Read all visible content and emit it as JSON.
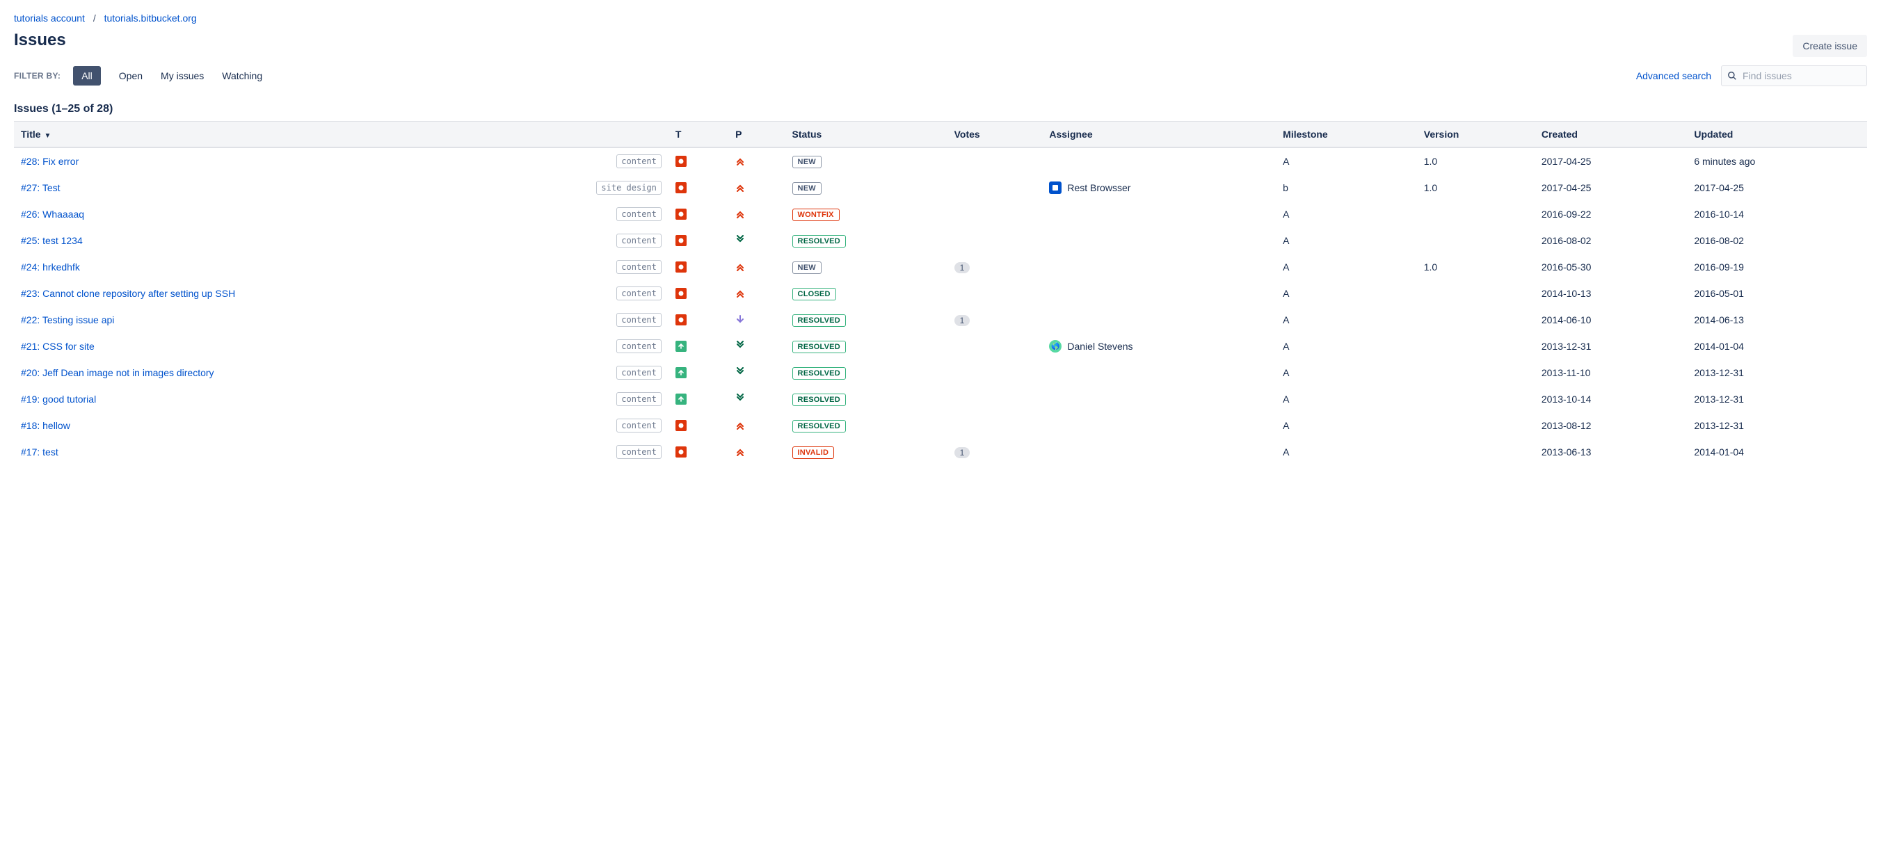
{
  "breadcrumb": {
    "account": "tutorials account",
    "repo": "tutorials.bitbucket.org"
  },
  "page_title": "Issues",
  "create_button": "Create issue",
  "filter_label": "FILTER BY:",
  "filters": [
    {
      "label": "All",
      "active": true
    },
    {
      "label": "Open",
      "active": false
    },
    {
      "label": "My issues",
      "active": false
    },
    {
      "label": "Watching",
      "active": false
    }
  ],
  "advanced_search": "Advanced search",
  "search_placeholder": "Find issues",
  "summary": "Issues (1–25 of 28)",
  "columns": {
    "title": "Title",
    "type": "T",
    "priority": "P",
    "status": "Status",
    "votes": "Votes",
    "assignee": "Assignee",
    "milestone": "Milestone",
    "version": "Version",
    "created": "Created",
    "updated": "Updated"
  },
  "issues": [
    {
      "id": "#28",
      "title": "Fix error",
      "tag": "content",
      "type": "bug",
      "priority": "highest",
      "status": "NEW",
      "status_class": "st-new",
      "votes": "",
      "assignee": "",
      "avatar": "",
      "milestone": "A",
      "version": "1.0",
      "created": "2017-04-25",
      "updated": "6 minutes ago"
    },
    {
      "id": "#27",
      "title": "Test",
      "tag": "site design",
      "type": "bug",
      "priority": "highest",
      "status": "NEW",
      "status_class": "st-new",
      "votes": "",
      "assignee": "Rest Browsser",
      "avatar": "bb",
      "milestone": "b",
      "version": "1.0",
      "created": "2017-04-25",
      "updated": "2017-04-25"
    },
    {
      "id": "#26",
      "title": "Whaaaaq",
      "tag": "content",
      "type": "bug",
      "priority": "highest",
      "status": "WONTFIX",
      "status_class": "st-wontfix",
      "votes": "",
      "assignee": "",
      "avatar": "",
      "milestone": "A",
      "version": "",
      "created": "2016-09-22",
      "updated": "2016-10-14"
    },
    {
      "id": "#25",
      "title": "test 1234",
      "tag": "content",
      "type": "bug",
      "priority": "lowest",
      "status": "RESOLVED",
      "status_class": "st-resolved",
      "votes": "",
      "assignee": "",
      "avatar": "",
      "milestone": "A",
      "version": "",
      "created": "2016-08-02",
      "updated": "2016-08-02"
    },
    {
      "id": "#24",
      "title": "hrkedhfk",
      "tag": "content",
      "type": "bug",
      "priority": "highest",
      "status": "NEW",
      "status_class": "st-new",
      "votes": "1",
      "assignee": "",
      "avatar": "",
      "milestone": "A",
      "version": "1.0",
      "created": "2016-05-30",
      "updated": "2016-09-19"
    },
    {
      "id": "#23",
      "title": "Cannot clone repository after setting up SSH",
      "tag": "content",
      "type": "bug",
      "priority": "highest",
      "status": "CLOSED",
      "status_class": "st-closed",
      "votes": "",
      "assignee": "",
      "avatar": "",
      "milestone": "A",
      "version": "",
      "created": "2014-10-13",
      "updated": "2016-05-01"
    },
    {
      "id": "#22",
      "title": "Testing issue api",
      "tag": "content",
      "type": "bug",
      "priority": "low",
      "status": "RESOLVED",
      "status_class": "st-resolved",
      "votes": "1",
      "assignee": "",
      "avatar": "",
      "milestone": "A",
      "version": "",
      "created": "2014-06-10",
      "updated": "2014-06-13"
    },
    {
      "id": "#21",
      "title": "CSS for site",
      "tag": "content",
      "type": "improvement",
      "priority": "lowest",
      "status": "RESOLVED",
      "status_class": "st-resolved",
      "votes": "",
      "assignee": "Daniel Stevens",
      "avatar": "user",
      "milestone": "A",
      "version": "",
      "created": "2013-12-31",
      "updated": "2014-01-04"
    },
    {
      "id": "#20",
      "title": "Jeff Dean image not in images directory",
      "tag": "content",
      "type": "improvement",
      "priority": "lowest",
      "status": "RESOLVED",
      "status_class": "st-resolved",
      "votes": "",
      "assignee": "",
      "avatar": "",
      "milestone": "A",
      "version": "",
      "created": "2013-11-10",
      "updated": "2013-12-31"
    },
    {
      "id": "#19",
      "title": "good tutorial",
      "tag": "content",
      "type": "improvement",
      "priority": "lowest",
      "status": "RESOLVED",
      "status_class": "st-resolved",
      "votes": "",
      "assignee": "",
      "avatar": "",
      "milestone": "A",
      "version": "",
      "created": "2013-10-14",
      "updated": "2013-12-31"
    },
    {
      "id": "#18",
      "title": "hellow",
      "tag": "content",
      "type": "bug",
      "priority": "highest",
      "status": "RESOLVED",
      "status_class": "st-resolved",
      "votes": "",
      "assignee": "",
      "avatar": "",
      "milestone": "A",
      "version": "",
      "created": "2013-08-12",
      "updated": "2013-12-31"
    },
    {
      "id": "#17",
      "title": "test",
      "tag": "content",
      "type": "bug",
      "priority": "highest",
      "status": "INVALID",
      "status_class": "st-invalid",
      "votes": "1",
      "assignee": "",
      "avatar": "",
      "milestone": "A",
      "version": "",
      "created": "2013-06-13",
      "updated": "2014-01-04"
    }
  ]
}
